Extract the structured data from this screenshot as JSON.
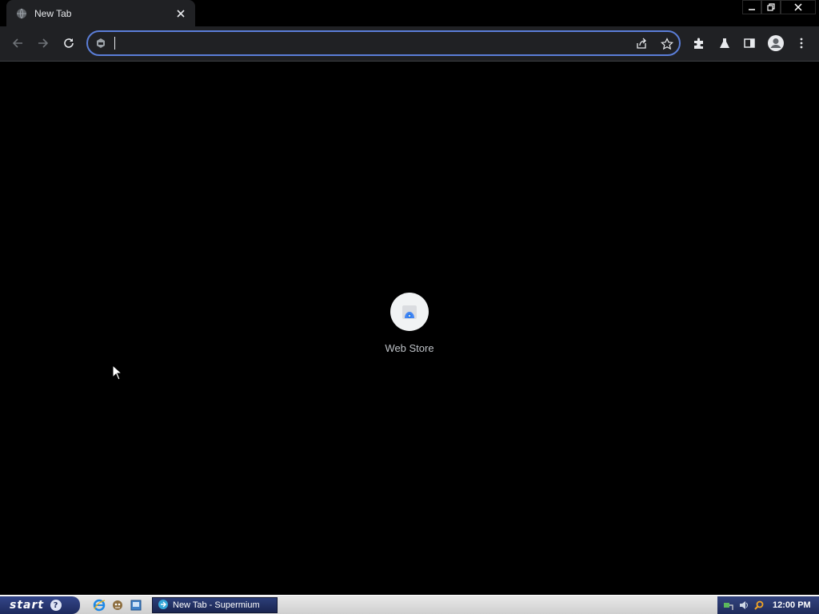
{
  "browser": {
    "tab": {
      "title": "New Tab"
    },
    "omnibox": {
      "value": "",
      "placeholder": ""
    }
  },
  "new_tab_page": {
    "shortcuts": [
      {
        "label": "Web Store"
      }
    ]
  },
  "taskbar": {
    "start_label": "start",
    "tasks": [
      {
        "label": "New Tab - Supermium"
      }
    ],
    "clock": "12:00 PM"
  },
  "colors": {
    "background": "#000000",
    "toolbar": "#202124",
    "omnibox_focus_border": "#5b7ed8",
    "taskbar_blue": "#1d2a5c"
  },
  "icons": {
    "tab_favicon": "globe-icon",
    "tab_close": "close-icon",
    "minimize": "minimize-icon",
    "restore": "restore-icon",
    "close": "close-icon",
    "back": "back-arrow-icon",
    "forward": "forward-arrow-icon",
    "reload": "reload-icon",
    "share": "share-icon",
    "bookmark": "star-icon",
    "extensions": "puzzle-icon",
    "labs": "flask-icon",
    "side_panel": "side-panel-icon",
    "profile": "profile-icon",
    "menu": "more-vert-icon",
    "web_store": "web-store-icon"
  }
}
